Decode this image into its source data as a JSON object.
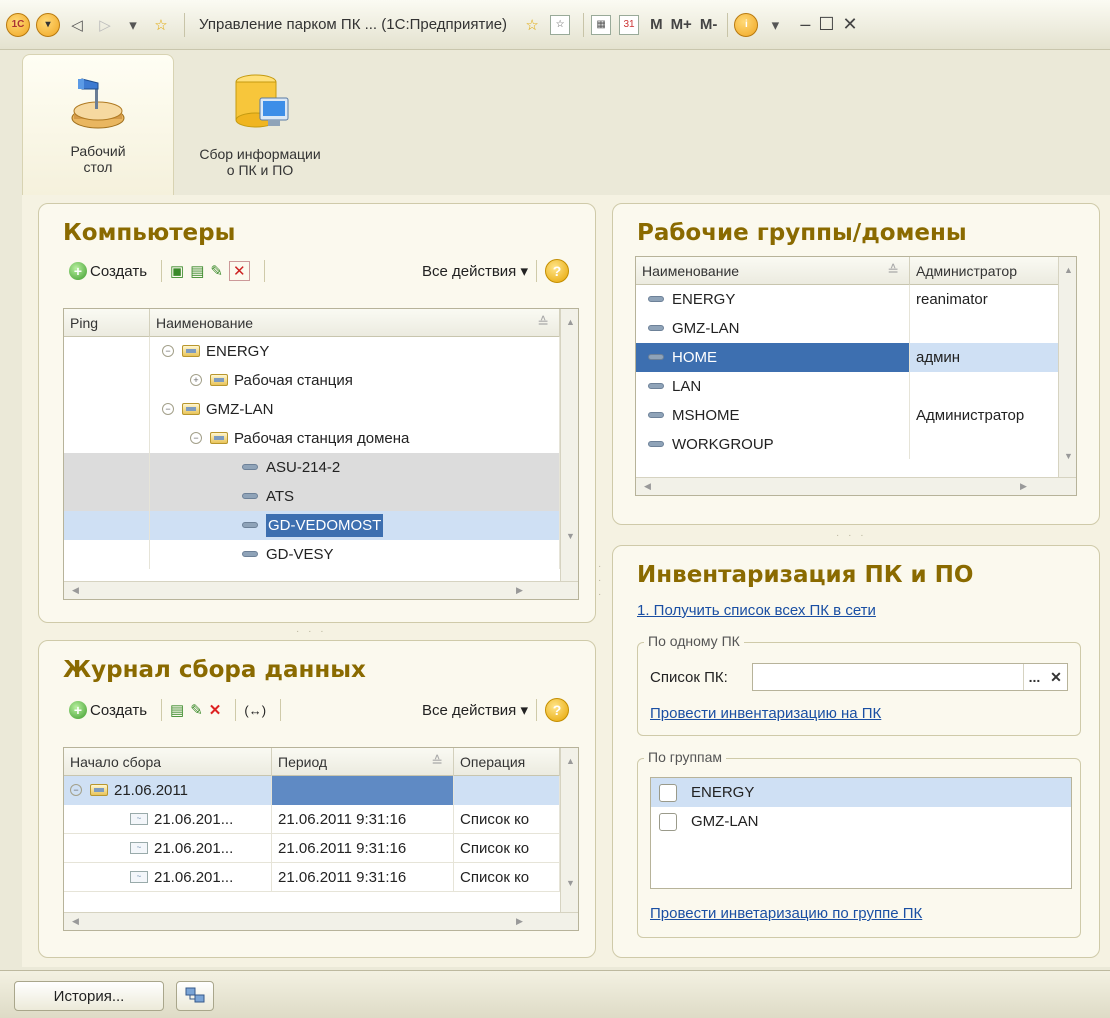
{
  "titlebar": {
    "title": "Управление парком ПК ... (1С:Предприятие)",
    "logo": "1С",
    "m_label": "M",
    "mplus_label": "M+",
    "mminus_label": "M-"
  },
  "nav": {
    "tabs": [
      {
        "label_line1": "Рабочий",
        "label_line2": "стол",
        "icon": "desk-lamp-icon"
      },
      {
        "label_line1": "Сбор информации",
        "label_line2": "о ПК и ПО",
        "icon": "database-computer-icon"
      }
    ]
  },
  "computers": {
    "title": "Компьютеры",
    "create_label": "Создать",
    "all_actions": "Все действия ▾",
    "help": "?",
    "columns": [
      "Ping",
      "Наименование"
    ],
    "rows": [
      {
        "indent": 1,
        "expander": "−",
        "type": "folder",
        "name": "ENERGY"
      },
      {
        "indent": 2,
        "expander": "+",
        "type": "folder",
        "name": "Рабочая станция"
      },
      {
        "indent": 1,
        "expander": "−",
        "type": "folder",
        "name": "GMZ-LAN"
      },
      {
        "indent": 2,
        "expander": "−",
        "type": "folder",
        "name": "Рабочая станция домена"
      },
      {
        "indent": 3,
        "type": "item",
        "name": "ASU-214-2"
      },
      {
        "indent": 3,
        "type": "item",
        "name": "ATS"
      },
      {
        "indent": 3,
        "type": "item",
        "name": "GD-VEDOMOST"
      },
      {
        "indent": 3,
        "type": "item",
        "name": "GD-VESY"
      }
    ]
  },
  "workgroups": {
    "title": "Рабочие группы/домены",
    "columns": [
      "Наименование",
      "Администратор"
    ],
    "rows": [
      {
        "name": "ENERGY",
        "admin": "reanimator"
      },
      {
        "name": "GMZ-LAN",
        "admin": ""
      },
      {
        "name": "HOME",
        "admin": "админ"
      },
      {
        "name": "LAN",
        "admin": ""
      },
      {
        "name": "MSHOME",
        "admin": "Администратор"
      },
      {
        "name": "WORKGROUP",
        "admin": ""
      }
    ]
  },
  "journal": {
    "title": "Журнал сбора данных",
    "create_label": "Создать",
    "all_actions": "Все действия ▾",
    "help": "?",
    "columns": [
      "Начало сбора",
      "Период",
      "Операция"
    ],
    "group_row": "21.06.2011",
    "rows": [
      {
        "start": "21.06.201...",
        "period": "21.06.2011 9:31:16",
        "op": "Список ко"
      },
      {
        "start": "21.06.201...",
        "period": "21.06.2011 9:31:16",
        "op": "Список ко"
      },
      {
        "start": "21.06.201...",
        "period": "21.06.2011 9:31:16",
        "op": "Список ко"
      }
    ]
  },
  "inventory": {
    "title": "Инвентаризация ПК и ПО",
    "get_list_link": "1. Получить список всех ПК в сети",
    "single_group_label": "По одному ПК",
    "pc_list_label": "Список ПК:",
    "pc_list_value": "",
    "select_btn": "...",
    "clear_btn": "✕",
    "run_single_link": "Провести инвентаризацию на ПК",
    "groups_label": "По группам",
    "groups": [
      {
        "name": "ENERGY",
        "checked": false
      },
      {
        "name": "GMZ-LAN",
        "checked": false
      }
    ],
    "run_groups_link": "Провести инветаризацию по группе ПК"
  },
  "statusbar": {
    "history_label": "История..."
  },
  "colors": {
    "title_accent": "#8a6a00",
    "selection": "#cfe0f4",
    "selection_strong": "#3d6fb0",
    "link": "#1a4fa3"
  }
}
